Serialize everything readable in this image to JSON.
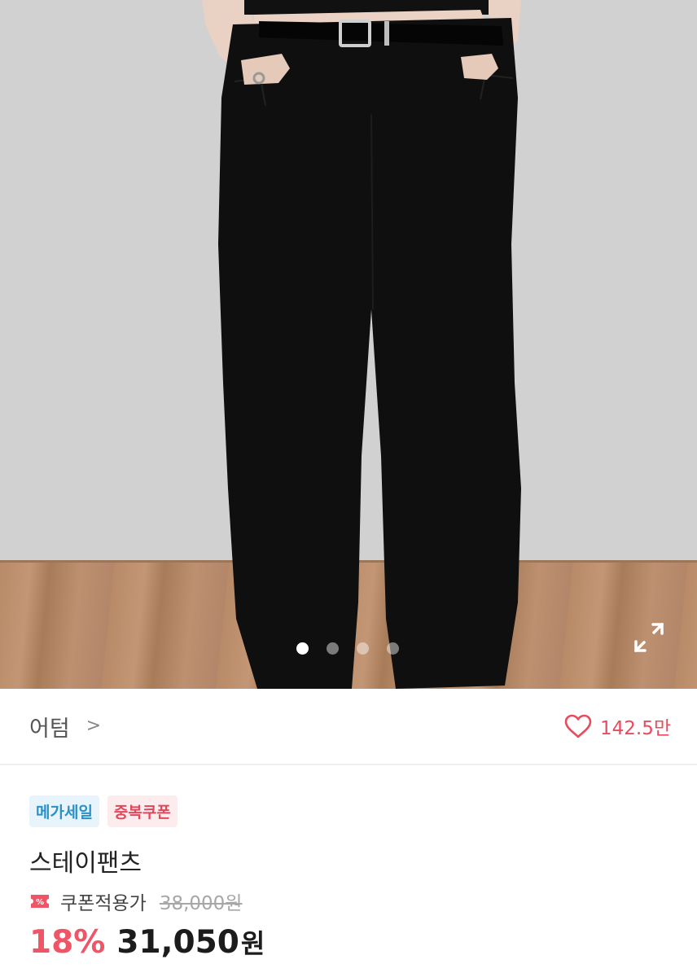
{
  "product_image": {
    "alt": "black wide pants",
    "slide_count": 4,
    "active_slide_index": 0,
    "expand_icon": "expand-icon"
  },
  "brand": {
    "name": "어텀",
    "chevron": ">",
    "chevron_icon": "chevron-right-icon"
  },
  "like": {
    "icon": "heart-icon",
    "count": "142.5만",
    "color": "#e84b5d"
  },
  "badges": [
    {
      "label": "메가세일",
      "bg": "#e8f4fb",
      "color": "#2a90c8"
    },
    {
      "label": "중복쿠폰",
      "bg": "#fdeced",
      "color": "#e0485c"
    }
  ],
  "product": {
    "name": "스테이팬츠",
    "coupon_icon": "coupon-ticket-icon",
    "coupon_label": "쿠폰적용가",
    "original_price": "38,000원",
    "discount_rate": "18%",
    "sale_price": "31,050",
    "currency": "원",
    "discount_color": "#ef5467"
  }
}
